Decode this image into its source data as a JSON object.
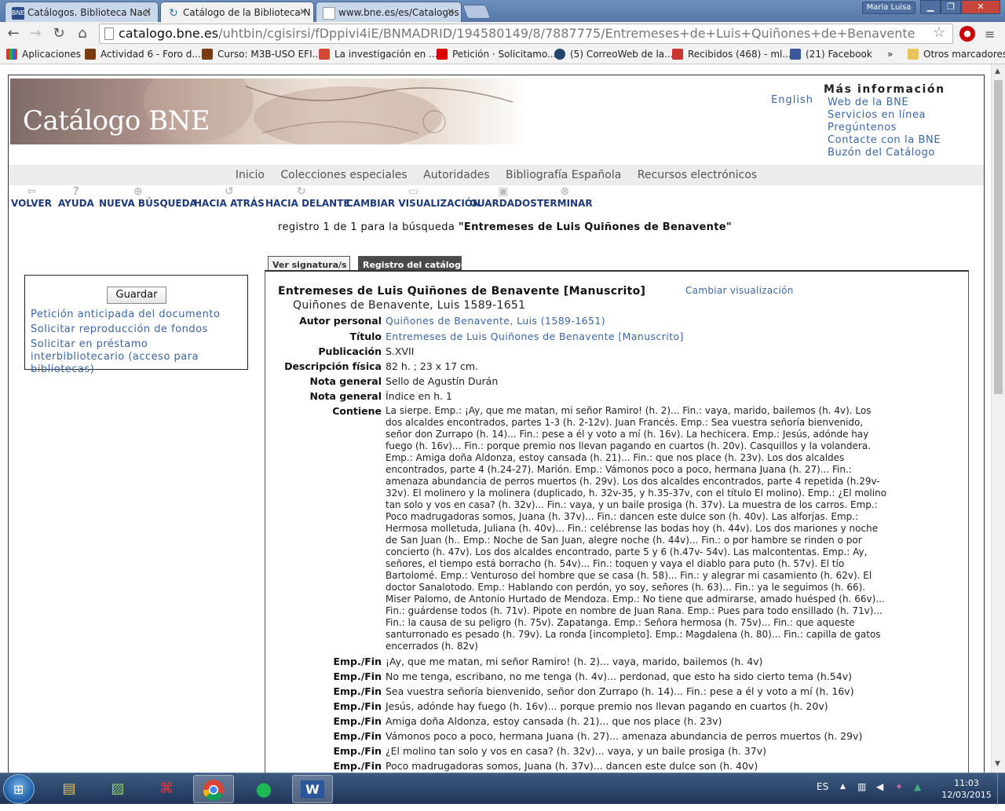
{
  "browser": {
    "tabs": [
      {
        "title": "Catálogos. Biblioteca Naci",
        "favicon": "bne-icon"
      },
      {
        "title": "Catálogo de la Biblioteca N",
        "favicon": "loading-icon"
      },
      {
        "title": "www.bne.es/es/Catalogos",
        "favicon": "page-icon"
      }
    ],
    "user": "Maria Luisa",
    "url_host": "catalogo.bne.es",
    "url_path": "/uhtbin/cgisirsi/fDppivi4iE/BNMADRID/194580149/8/7887775/Entremeses+de+Luis+Quiñones+de+Benavente",
    "bookmarks": [
      "Aplicaciones",
      "Actividad 6 - Foro d...",
      "Curso: M3B-USO EFI...",
      "La investigación en ...",
      "Petición · Solicitamo...",
      "(5) CorreoWeb de la...",
      "Recibidos (468) - ml...",
      "(21) Facebook",
      "»",
      "Otros marcadores"
    ]
  },
  "header": {
    "banner_title": "Catálogo BNE",
    "english": "English",
    "more_info_title": "Más información",
    "more_info_links": [
      "Web de la BNE",
      "Servicios en línea",
      "Pregúntenos",
      "Contacte con la BNE",
      "Buzón del Catálogo"
    ]
  },
  "nav": [
    "Inicio",
    "Colecciones especiales",
    "Autoridades",
    "Bibliografía Española",
    "Recursos electrónicos"
  ],
  "tools": [
    "VOLVER",
    "AYUDA",
    "NUEVA BÚSQUEDA",
    "HACIA ATRÁS",
    "HACIA DELANTE",
    "CAMBIAR VISUALIZACIÓN",
    "GUARDADOS",
    "TERMINAR"
  ],
  "search_info": {
    "prefix": "registro 1 de 1 para la búsqueda",
    "query": "\"Entremeses de Luis Quiñones de Benavente\""
  },
  "record_tabs": [
    "Ver signatura/s",
    "Registro del catálogo"
  ],
  "left_panel": {
    "save": "Guardar",
    "links": [
      "Petición anticipada del documento",
      "Solicitar reproducción de fondos",
      "Solicitar en préstamo interbibliotecario (acceso para bibliotecas)"
    ]
  },
  "record": {
    "title": "Entremeses de Luis Quiñones de Benavente [Manuscrito]",
    "subtitle": "Quiñones de Benavente, Luis 1589-1651",
    "change_view": "Cambiar visualización",
    "fields": [
      {
        "label": "Autor personal",
        "value": "Quiñones de Benavente, Luis (1589-1651)",
        "link": true
      },
      {
        "label": "Título",
        "value": "Entremeses de Luis Quiñones de Benavente [Manuscrito]",
        "link": true
      },
      {
        "label": "Publicación",
        "value": "S.XVII"
      },
      {
        "label": "Descripción física",
        "value": "82 h. ; 23 x 17 cm."
      },
      {
        "label": "Nota general",
        "value": "Sello de Agustín Durán"
      },
      {
        "label": "Nota general",
        "value": "Índice en h. 1"
      },
      {
        "label": "Contiene",
        "value": "La sierpe. Emp.: ¡Ay, que me matan, mi señor Ramiro! (h. 2)... Fin.: vaya, marido, bailemos (h. 4v). Los dos alcaldes encontrados, partes 1-3 (h. 2-12v). Juan Francés. Emp.: Sea vuestra señoría bienvenido, señor don Zurrapo (h. 14)... Fin.: pese a él y voto a mí (h. 16v). La hechicera. Emp.: Jesús, adónde hay fuego (h. 16v)... Fin.: porque premio nos llevan pagando en cuartos (h. 20v). Casquillos y la volandera. Emp.: Amiga doña Aldonza, estoy cansada (h. 21)... Fin.: que nos place (h. 23v). Los dos alcaldes encontrados, parte 4 (h.24-27). Marión. Emp.: Vámonos poco a poco, hermana Juana (h. 27)... Fin.: amenaza abundancia de perros muertos (h. 29v). Los dos alcaldes encontrados, parte 4 repetida (h.29v-32v). El molinero y la molinera (duplicado, h. 32v-35, y h.35-37v, con el título El molino). Emp.: ¿El molino tan solo y vos en casa? (h. 32v)... Fin.: vaya, y un baile prosiga (h. 37v). La muestra de los carros. Emp.: Poco madrugadoras somos, Juana (h. 37v)... Fin.: dancen este dulce son (h. 40v). Las alforjas. Emp.: Hermosa molletuda, Juliana (h. 40v)... Fin.: celébrense las bodas hoy (h. 44v). Los dos mariones y noche de San Juan (h.. Emp.: Noche de San Juan, alegre noche (h. 44v)... Fin.: o por hambre se rinden o por concierto (h. 47v). Los dos alcaldes encontrado, parte 5 y 6 (h.47v- 54v). Las malcontentas. Emp.: Ay, señores, el tiempo está borracho (h. 54v)... Fin.: toquen y vaya el diablo para puto (h. 57v). El tío Bartolomé. Emp.: Venturoso del hombre que se casa (h. 58)... Fin.: y alegrar mi casamiento (h. 62v). El doctor Sanalotodo. Emp.: Hablando con perdón, yo soy, señores (h. 63)... Fin.: ya le seguimos (h. 66). Miser Palomo, de Antonio Hurtado de Mendoza. Emp.: No tiene que admirarse, amado huésped (h. 66v)... Fin.: guárdense todos (h. 71v). Pipote en nombre de Juan Rana. Emp.: Pues para todo ensillado (h. 71v)... Fin.: la causa de su peligro (h. 75v). Zapatanga. Emp.: Señora hermosa (h. 75v)... Fin.: que aqueste santurronado es pesado (h. 79v). La ronda [incompleto]. Emp.: Magdalena (h. 80)... Fin.: capilla de gatos encerrados (h. 82v)"
      },
      {
        "label": "Emp./Fin",
        "value": "¡Ay, que me matan, mi señor Ramiro! (h. 2)... vaya, marido, bailemos (h. 4v)"
      },
      {
        "label": "Emp./Fin",
        "value": "No me tenga, escribano, no me tenga (h. 4v)... perdonad, que esto ha sido cierto tema (h.54v)"
      },
      {
        "label": "Emp./Fin",
        "value": "Sea vuestra señoría bienvenido, señor don Zurrapo (h. 14)... Fin.: pese a él y voto a mí (h. 16v)"
      },
      {
        "label": "Emp./Fin",
        "value": "Jesús, adónde hay fuego (h. 16v)... porque premio nos llevan pagando en cuartos (h. 20v)"
      },
      {
        "label": "Emp./Fin",
        "value": "Amiga doña Aldonza, estoy cansada (h. 21)... que nos place (h. 23v)"
      },
      {
        "label": "Emp./Fin",
        "value": "Vámonos poco a poco, hermana Juana (h. 27)... amenaza abundancia de perros muertos (h. 29v)"
      },
      {
        "label": "Emp./Fin",
        "value": "¿El molino tan solo y vos en casa? (h. 32v)... vaya, y un baile prosiga (h. 37v)"
      },
      {
        "label": "Emp./Fin",
        "value": "Poco madrugadoras somos, Juana (h. 37v)... dancen este dulce son (h. 40v)"
      }
    ]
  },
  "taskbar": {
    "lang": "ES",
    "time": "11:03",
    "date": "12/03/2015",
    "apps": [
      "explorer-icon",
      "image-viewer-icon",
      "acrobat-icon",
      "chrome-icon",
      "spotify-icon",
      "word-icon"
    ]
  },
  "colors": {
    "link": "#3a66a8",
    "tool": "#1d3a7a",
    "active_tab": "#4a4a4a"
  }
}
